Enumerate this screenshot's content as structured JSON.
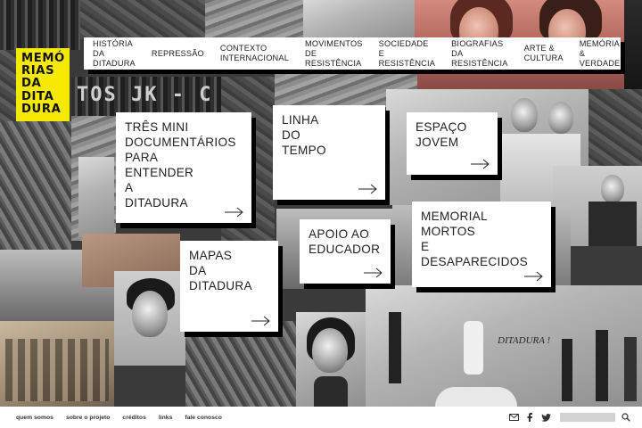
{
  "logo": {
    "lines": [
      "MEMÓ",
      "RIAS",
      "DA",
      "DITA",
      "DURA"
    ],
    "color": "#f5e900"
  },
  "nav": {
    "items": [
      {
        "label": "HISTÓRIA DA\nDITADURA"
      },
      {
        "label": "REPRESSÃO"
      },
      {
        "label": "CONTEXTO\nINTERNACIONAL"
      },
      {
        "label": "MOVIMENTOS\nDE RESISTÊNCIA"
      },
      {
        "label": "SOCIEDADE E\nRESISTÊNCIA"
      },
      {
        "label": "BIOGRAFIAS DA\nRESISTÊNCIA"
      },
      {
        "label": "ARTE &\nCULTURA"
      },
      {
        "label": "MEMÓRIA\n& VERDADE"
      }
    ]
  },
  "tiles": {
    "tres_mini": "TRÊS MINI\nDOCUMENTÁRIOS\nPARA\nENTENDER\nA\nDITADURA",
    "linha": "LINHA\nDO\nTEMPO",
    "espaco": "ESPAÇO\nJOVEM",
    "apoio": "APOIO AO\nEDUCADOR",
    "memorial": "MEMORIAL\nMORTOS\nE\nDESAPARECIDOS",
    "mapas": "MAPAS\nDA\nDITADURA"
  },
  "background_text": {
    "sign": "TOS JK - C",
    "wall": "DITADURA !"
  },
  "footer": {
    "links": [
      "quem somos",
      "sobre o projeto",
      "créditos",
      "links",
      "fale conosco"
    ],
    "icons": [
      "mail-icon",
      "facebook-icon",
      "twitter-icon",
      "search-icon"
    ],
    "search_placeholder": ""
  }
}
